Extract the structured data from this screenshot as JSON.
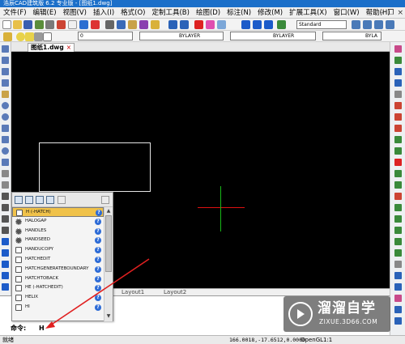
{
  "window": {
    "title": "浩辰CAD建筑版 6.2 专业版 - [图纸1.dwg]"
  },
  "menubar": {
    "items": [
      "文件(F)",
      "编辑(E)",
      "视图(V)",
      "插入(I)",
      "格式(O)",
      "定制工具(B)",
      "绘图(D)",
      "标注(N)",
      "修改(M)",
      "扩展工具(X)",
      "窗口(W)",
      "帮助(H)"
    ]
  },
  "toolbar": {
    "text_style": "Standard",
    "layer_value": "0",
    "color_value": "BYLAYER",
    "linetype_value": "BYLAYER",
    "lineweight_value": "BYLA"
  },
  "document": {
    "tab_label": "图纸1.dwg",
    "close_glyph": "×"
  },
  "layout_tabs": [
    "Layout1",
    "Layout2"
  ],
  "autocomplete": {
    "items": [
      "H (-HATCH)",
      "HALOGAP",
      "HANDLES",
      "HANDSEED",
      "HANDUCOPY",
      "HATCHEDIT",
      "HATCHGENERATEBOUNDARY",
      "HATCHTOBACK",
      "HE (-HATCHEDIT)",
      "HELIX",
      "HI"
    ],
    "selected_index": 0,
    "help_glyph": "?"
  },
  "command": {
    "prompt": "命令:",
    "input": "H"
  },
  "status": {
    "left_text": "就绪",
    "coords": "166.0018,-17.6512,0.0000",
    "renderer": "OpenGL",
    "scale": "1:1"
  },
  "watermark": {
    "name": "溜溜自学",
    "url": "ZIXUE.3D66.COM"
  },
  "colors": {
    "canvas": "#000000",
    "selection": "#f0c24a",
    "crosshair_x": "#d11111",
    "crosshair_y": "#18b818",
    "annotation_arrow": "#e02020"
  }
}
